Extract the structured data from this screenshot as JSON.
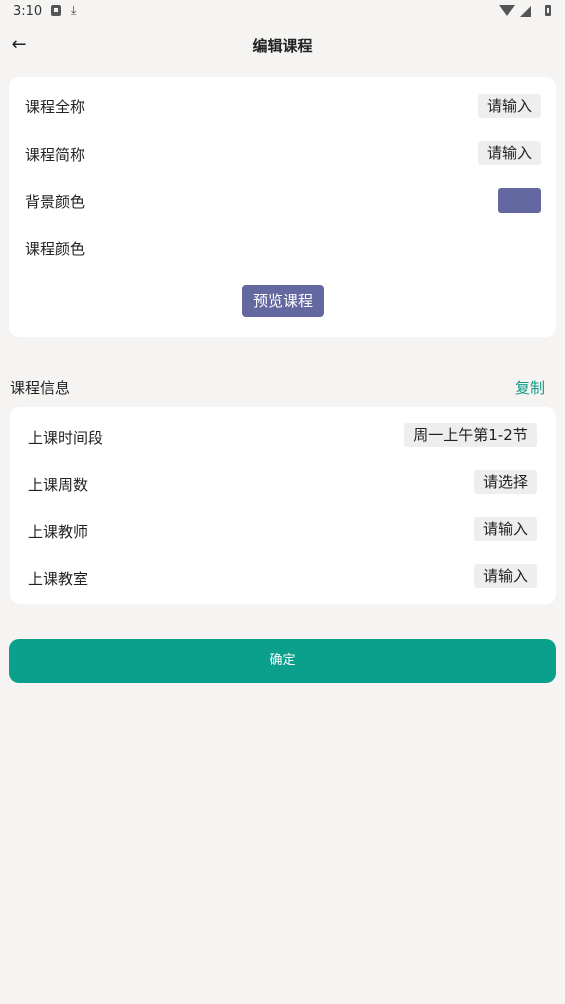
{
  "status_bar": {
    "time": "3:10"
  },
  "app_bar": {
    "title": "编辑课程"
  },
  "course_card": {
    "full_name": {
      "label": "课程全称",
      "value": "请输入"
    },
    "short_name": {
      "label": "课程简称",
      "value": "请输入"
    },
    "background_color": {
      "label": "背景颜色",
      "color": "#6468a0"
    },
    "course_color": {
      "label": "课程颜色",
      "color": "#ffffff"
    },
    "preview_label": "预览课程"
  },
  "info_section": {
    "title": "课程信息",
    "copy_label": "复制",
    "rows": [
      {
        "label": "上课时间段",
        "value": "周一上午第1-2节"
      },
      {
        "label": "上课周数",
        "value": "请选择"
      },
      {
        "label": "上课教师",
        "value": "请输入"
      },
      {
        "label": "上课教室",
        "value": "请输入"
      }
    ]
  },
  "confirm_label": "确定",
  "colors": {
    "accent": "#0ba08b",
    "preview": "#6468a0",
    "background": "#f5f4f2"
  }
}
